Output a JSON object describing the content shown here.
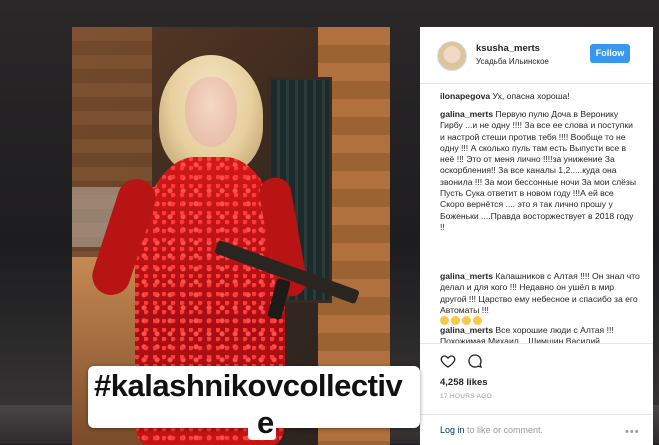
{
  "post": {
    "hashtag_line1": "#kalashnikovcollectiv",
    "hashtag_line2": "e"
  },
  "header": {
    "username": "ksusha_merts",
    "location": "Усадьба Ильинское",
    "follow_label": "Follow"
  },
  "comments": [
    {
      "user": "ilonapegova",
      "text": "Ух, опасна хороша!"
    },
    {
      "user": "galina_merts",
      "text": "Первую пулю Доча в Веронику Гирбу ...и не одну !!!! За все ее слова и поступки и настрой стеши против тебя !!!! Вообще то не одну !!! А сколько пуль там есть Выпусти все в неё !!! Это от меня лично !!!!за унижение За оскорбления!! За все каналы 1,2.....куда она звонила !!! За мои бессонные ночи За мои слёзы Пусть Сука ответит в новом году !!!А ей все Скоро вернётся .... это я так лично прошу у Боженьки ....Правда восторжествует в 2018 году !!"
    },
    {
      "user": "galina_merts",
      "text": "Калашников с Алтая !!!! Он знал что делал и для кого !!! Недавно он ушёл в мир другой !!! Царство ему небесное и спасибо за его Автоматы !!!"
    },
    {
      "user": "galina_merts",
      "text": "Все хорошие люди с Алтая !!! Похожимая Михаил ...Шимшин Василий"
    }
  ],
  "actions": {
    "likes": "4,258 likes",
    "time": "17 HOURS AGO",
    "login_link": "Log in",
    "login_rest": " to like or comment.",
    "more": "•••"
  },
  "icons": {
    "like": "heart-icon",
    "comment": "comment-icon",
    "more": "more-icon"
  },
  "colors": {
    "follow_button": "#3897f0",
    "dress": "#d21818"
  }
}
